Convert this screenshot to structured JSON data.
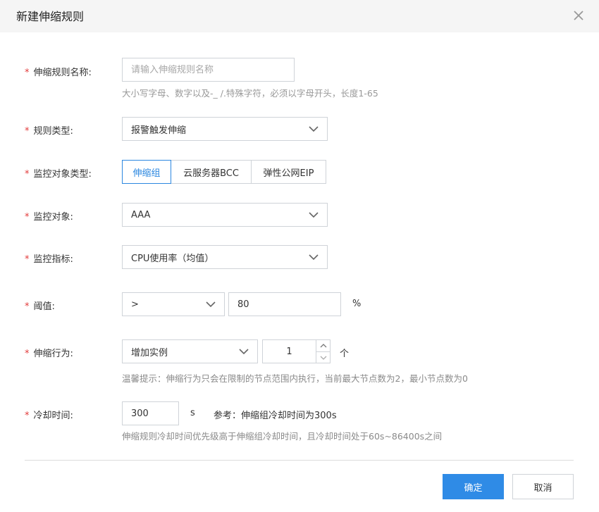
{
  "dialog": {
    "title": "新建伸缩规则",
    "required_mark": "*"
  },
  "form": {
    "rule_name": {
      "label": "伸缩规则名称:",
      "placeholder": "请输入伸缩规则名称",
      "hint": "大小写字母、数字以及-_ /.特殊字符，必须以字母开头，长度1-65"
    },
    "rule_type": {
      "label": "规则类型:",
      "value": "报警触发伸缩"
    },
    "monitor_object_type": {
      "label": "监控对象类型:",
      "options": [
        "伸缩组",
        "云服务器BCC",
        "弹性公网EIP"
      ],
      "selected": "伸缩组"
    },
    "monitor_object": {
      "label": "监控对象:",
      "value": "AAA"
    },
    "monitor_metric": {
      "label": "监控指标:",
      "value": "CPU使用率（均值）"
    },
    "threshold": {
      "label": "阈值:",
      "operator": ">",
      "value": "80",
      "unit": "%"
    },
    "scaling_action": {
      "label": "伸缩行为:",
      "action": "增加实例",
      "count": "1",
      "unit": "个",
      "hint": "温馨提示：伸缩行为只会在限制的节点范围内执行，当前最大节点数为2，最小节点数为0"
    },
    "cooldown": {
      "label": "冷却时间:",
      "value": "300",
      "unit": "s",
      "reference": "参考：伸缩组冷却时间为300s",
      "hint": "伸缩规则冷却时间优先级高于伸缩组冷却时间，且冷却时间处于60s~86400s之间"
    }
  },
  "footer": {
    "confirm_label": "确定",
    "cancel_label": "取消"
  },
  "colors": {
    "primary": "#2f8be6",
    "required": "#e23b3b",
    "hint": "#999999",
    "border": "#cfd3d8"
  },
  "icons": {
    "close": "close-icon",
    "dropdown": "chevron-down-icon",
    "step_up": "chevron-up-icon",
    "step_down": "chevron-down-icon"
  }
}
